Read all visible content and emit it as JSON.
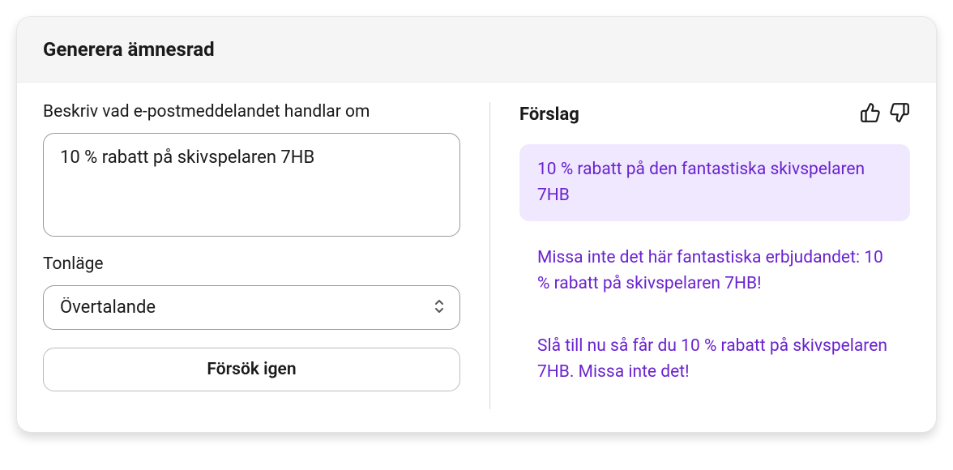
{
  "header": {
    "title": "Generera ämnesrad"
  },
  "left": {
    "describe_label": "Beskriv vad e-postmeddelandet handlar om",
    "describe_value": "10 % rabatt på skivspelaren 7HB",
    "tone_label": "Tonläge",
    "tone_value": "Övertalande",
    "retry_label": "Försök igen"
  },
  "right": {
    "suggestions_label": "Förslag",
    "items": [
      "10 % rabatt på den fantastiska skivspelaren 7HB",
      "Missa inte det här fantastiska erbjudandet: 10 % rabatt på skivspelaren 7HB!",
      "Slå till nu så får du 10 % rabatt på skivspelaren 7HB. Missa inte det!"
    ]
  }
}
